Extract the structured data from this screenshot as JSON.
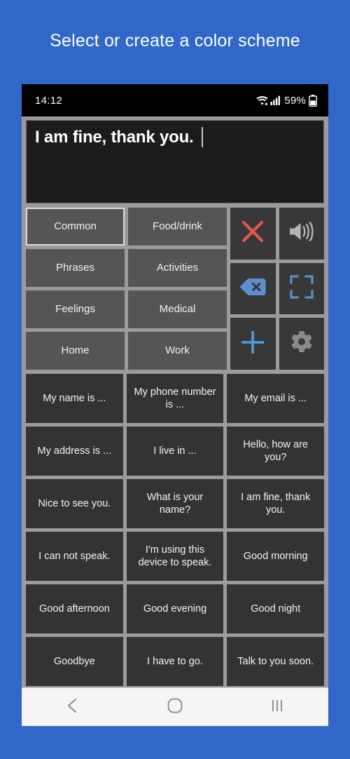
{
  "heading": "Select or create a color scheme",
  "colors": {
    "background": "#3068ca",
    "frame": "#9b9b9b",
    "statusbar": "#000000",
    "textbox": "#1c1c1c",
    "category_button": "#555555",
    "icon_button": "#383838",
    "phrase_button": "#333333",
    "navbar": "#f5f5f5",
    "accent_red": "#e8564d",
    "accent_blue": "#5c8fd1",
    "icon_gray": "#b4b4b4",
    "selected_border": "#dcdcdc"
  },
  "statusbar": {
    "time": "14:12",
    "battery_percent": "59%",
    "icons": [
      "wifi-icon",
      "signal-bars-icon",
      "battery-icon"
    ]
  },
  "textbox": {
    "value": "I am fine, thank you.",
    "placeholder": ""
  },
  "categories": [
    {
      "label": "Common",
      "selected": true
    },
    {
      "label": "Food/drink",
      "selected": false
    },
    {
      "label": "Phrases",
      "selected": false
    },
    {
      "label": "Activities",
      "selected": false
    },
    {
      "label": "Feelings",
      "selected": false
    },
    {
      "label": "Medical",
      "selected": false
    },
    {
      "label": "Home",
      "selected": false
    },
    {
      "label": "Work",
      "selected": false
    }
  ],
  "icon_keys": [
    {
      "name": "clear-text-icon",
      "glyph": "x",
      "color": "#e8564d"
    },
    {
      "name": "speak-icon",
      "glyph": "speaker",
      "color": "#b4b4b4"
    },
    {
      "name": "backspace-icon",
      "glyph": "backspace",
      "color": "#5c8fd1"
    },
    {
      "name": "fullscreen-icon",
      "glyph": "fullscreen",
      "color": "#5c8fd1"
    },
    {
      "name": "add-phrase-icon",
      "glyph": "plus",
      "color": "#4a9ee0"
    },
    {
      "name": "settings-icon",
      "glyph": "gear",
      "color": "#8a8a8a"
    }
  ],
  "phrases": [
    "My name is ...",
    "My phone number is ...",
    "My email is ...",
    "My address is ...",
    "I live in ...",
    "Hello, how are you?",
    "Nice to see you.",
    "What is your name?",
    "I am fine, thank you.",
    "I can not speak.",
    "I'm using this device to speak.",
    "Good morning",
    "Good afternoon",
    "Good evening",
    "Good night",
    "Goodbye",
    "I have to go.",
    "Talk to you soon."
  ],
  "navbar": {
    "back_label": "back-button",
    "home_label": "home-button",
    "recents_label": "recents-button"
  }
}
